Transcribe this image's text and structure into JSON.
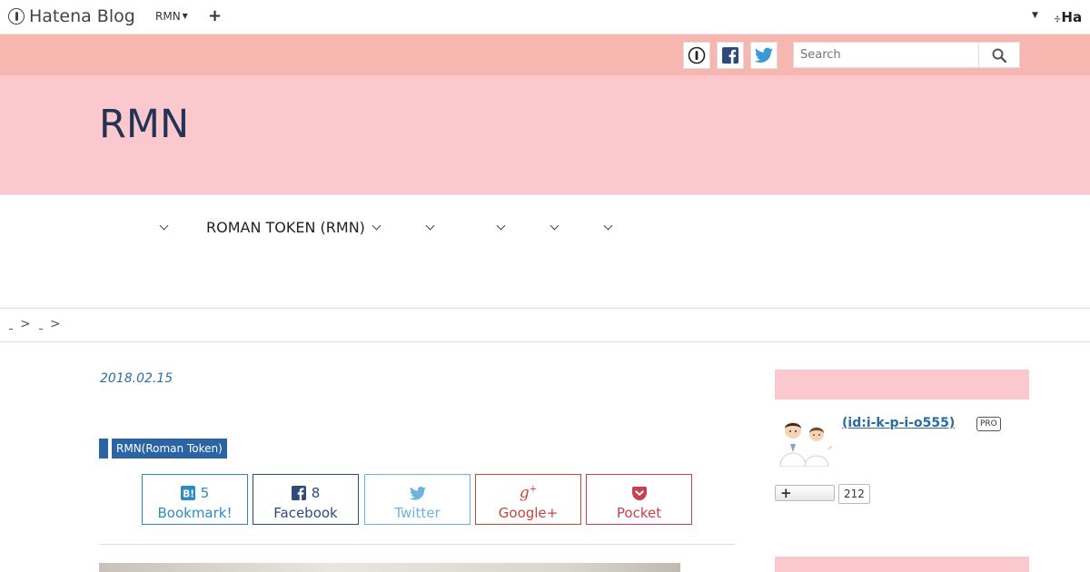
{
  "topbar": {
    "logo_text": "Hatena Blog",
    "blog_switch_label": "RMN",
    "add_label": "+",
    "right_logo_text": "Ha"
  },
  "social_bar": {
    "search_placeholder": "Search"
  },
  "header": {
    "blog_title": "RMN"
  },
  "nav": {
    "items": [
      {
        "label": ""
      },
      {
        "label": "ROMAN TOKEN (RMN)"
      },
      {
        "label": ""
      },
      {
        "label": ""
      },
      {
        "label": ""
      },
      {
        "label": ""
      }
    ]
  },
  "breadcrumb": {
    "separator": ">"
  },
  "article": {
    "date": "2018.02.15",
    "tags": [
      "",
      "RMN(Roman Token)"
    ],
    "share": {
      "hatena": {
        "count": "5",
        "label": "Bookmark!"
      },
      "facebook": {
        "count": "8",
        "label": "Facebook"
      },
      "twitter": {
        "label": "Twitter"
      },
      "gplus": {
        "label": "Google+"
      },
      "pocket": {
        "label": "Pocket"
      }
    }
  },
  "sidebar": {
    "profile_id": " (id:i-k-p-i-o555)",
    "pro_badge": "PRO",
    "follow_label": "+",
    "follow_count": "212"
  },
  "colors": {
    "social_bar": "#f7b6b0",
    "header_bg": "#fac8cd",
    "title": "#223356",
    "link": "#2a6ba5"
  }
}
